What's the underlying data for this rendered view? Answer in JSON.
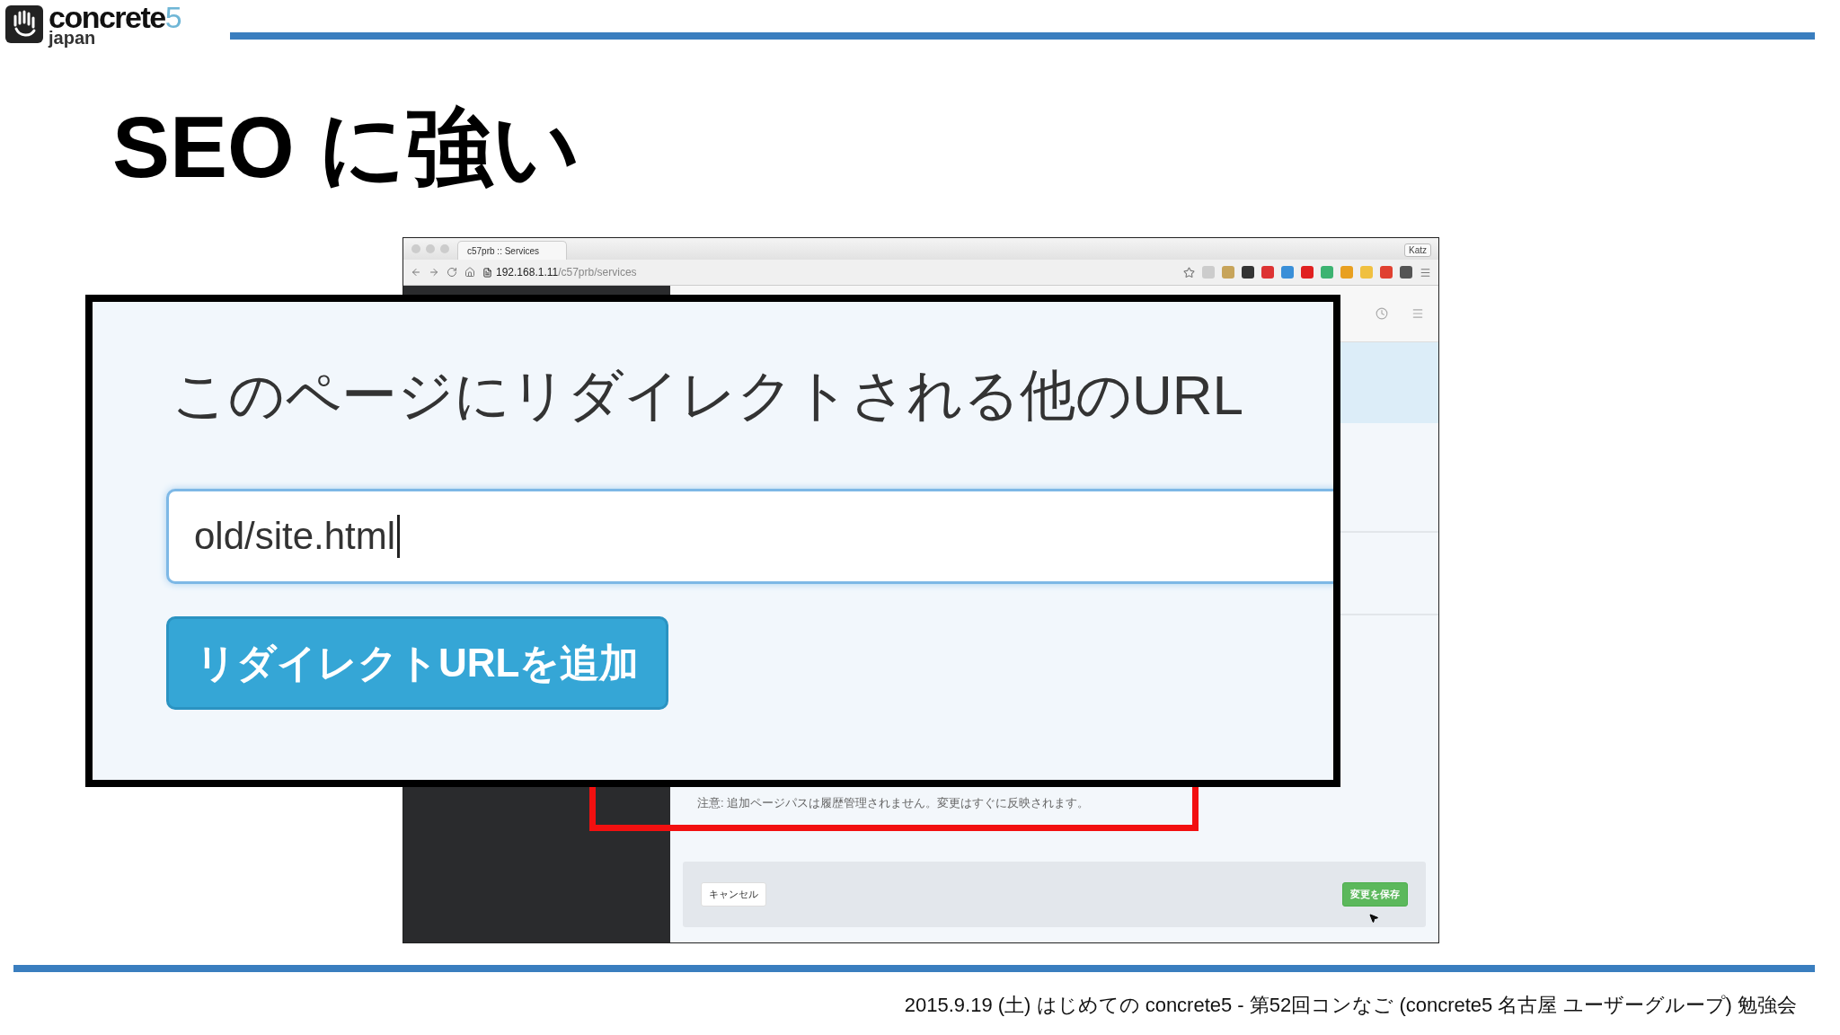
{
  "logo": {
    "word": "concrete",
    "digit": "5",
    "sub": "japan"
  },
  "title": "SEO に強い",
  "browser": {
    "tab": "c57prb :: Services",
    "user": "Katz",
    "url_host": "192.168.1.11",
    "url_path": "/c57prb/services",
    "note": "注意: 追加ページパスは履歴管理されません。変更はすぐに反映されます。",
    "buttons": [
      {
        "kind": "cancel",
        "label": "キャンセル"
      },
      {
        "kind": "save",
        "label": "変更を保存"
      }
    ]
  },
  "callout": {
    "heading": "このページにリダイレクトされる他のURL",
    "value": "old/site.html",
    "button": "リダイレクトURLを追加"
  },
  "footer": "2015.9.19 (土) はじめての concrete5 - 第52回コンなご (concrete5 名古屋 ユーザーグループ) 勉強会"
}
